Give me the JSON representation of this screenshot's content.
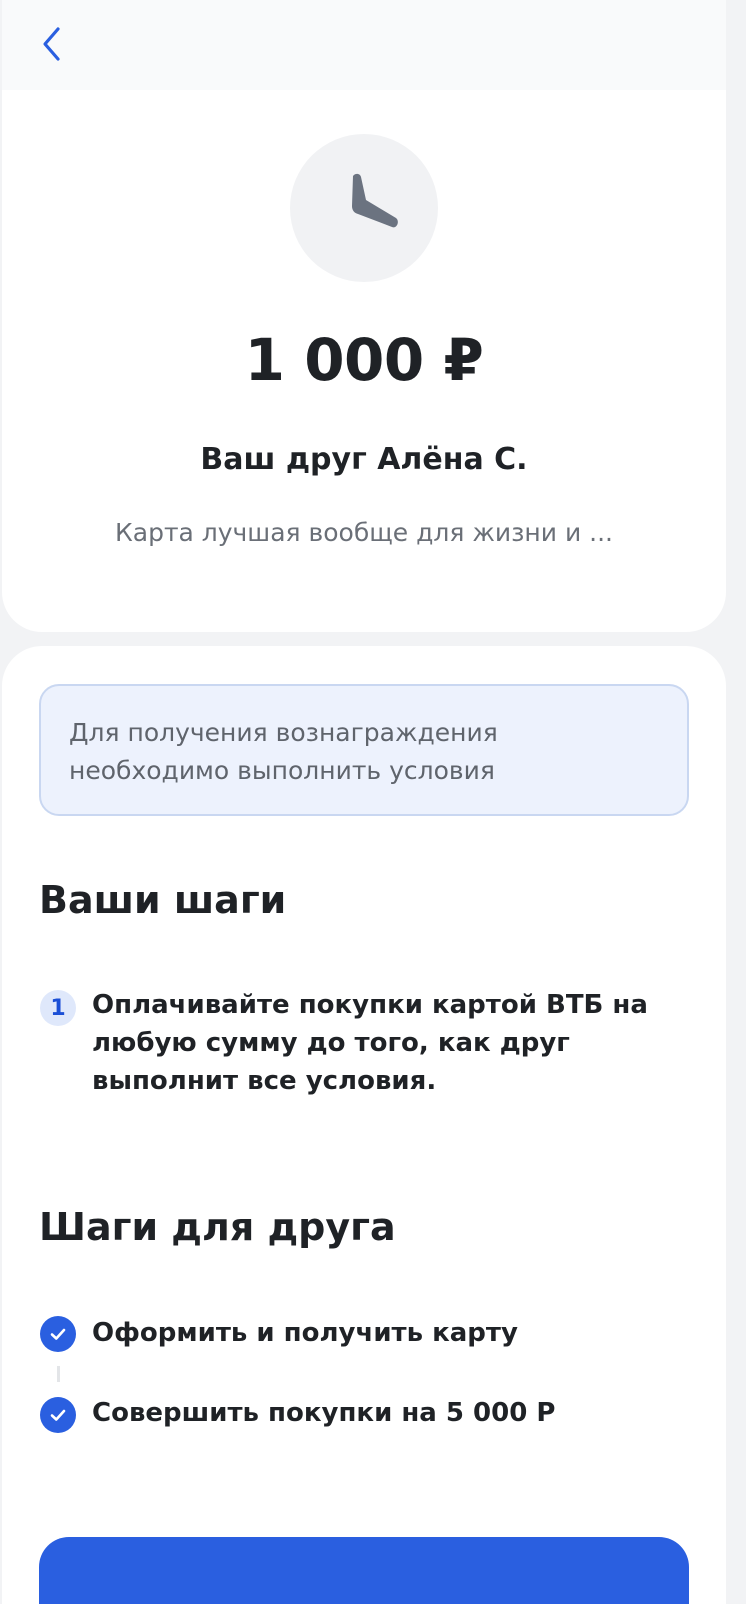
{
  "header": {
    "back_icon": "chevron-left-icon",
    "accent_color": "#2a5fe0"
  },
  "status": {
    "icon": "clock-icon",
    "amount": "1 000 ₽",
    "friend_name": "Ваш друг Алёна С.",
    "comment": "Карта лучшая вообще для жизни и ..."
  },
  "info": {
    "line1": "Для получения вознаграждения",
    "line2": "необходимо выполнить условия"
  },
  "your_steps": {
    "title": "Ваши шаги",
    "items": [
      {
        "number": "1",
        "text": "Оплачивайте покупки картой ВТБ на любую сумму до того, как друг выполнит все условия."
      }
    ]
  },
  "friend_steps": {
    "title": "Шаги для друга",
    "items": [
      {
        "text": "Оформить и получить карту",
        "icon": "check-icon",
        "done": true
      },
      {
        "text": "Совершить покупки на 5 000 Р",
        "icon": "check-icon",
        "done": true
      }
    ]
  }
}
